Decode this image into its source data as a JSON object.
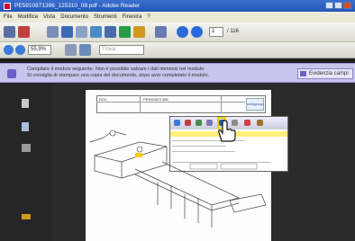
{
  "window": {
    "title": "PE5910871396_125310_08.pdf - Adobe Reader"
  },
  "menu": [
    "File",
    "Modifica",
    "Vista",
    "Documento",
    "Strumenti",
    "Finestra",
    "?"
  ],
  "toolbar": {
    "page_current": "1",
    "page_total": "/ 116",
    "zoom": "55,9%",
    "find_placeholder": "Trova"
  },
  "notice": {
    "line1": "Compilare il modulo seguente. Non è possibile salvare i dati immessi nel modulo.",
    "line2": "Si consiglia di stampare una copia del documento, dopo aver completato il modulo.",
    "action": "Evidenzia campi"
  },
  "document": {
    "header_label": "DOC",
    "header_value": "PE5910871396",
    "logo_text": "weldgroup"
  },
  "colors": {
    "notice_bg": "#c8c4ec",
    "titlebar": "#2a5cc0",
    "highlight": "#f0d000"
  }
}
